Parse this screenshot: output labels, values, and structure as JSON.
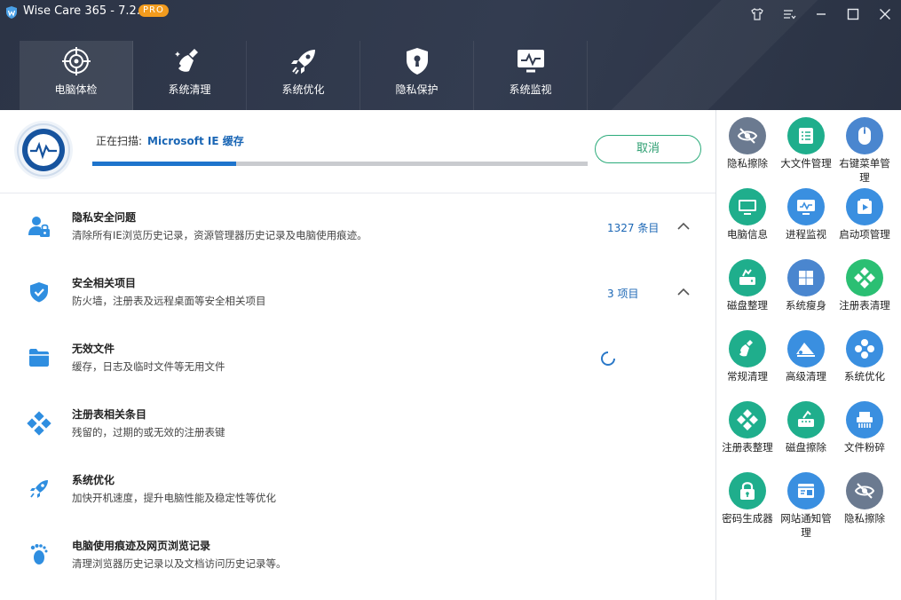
{
  "window": {
    "title": "Wise Care 365 - 7.2.5",
    "badge": "PRO",
    "controls": [
      "skin-icon",
      "menu-icon",
      "minimize-icon",
      "maximize-icon",
      "close-icon"
    ]
  },
  "tabs": [
    {
      "label": "电脑体检",
      "icon": "target-icon",
      "active": true
    },
    {
      "label": "系统清理",
      "icon": "broom-icon",
      "active": false
    },
    {
      "label": "系统优化",
      "icon": "rocket-icon",
      "active": false
    },
    {
      "label": "隐私保护",
      "icon": "shield-keyhole-icon",
      "active": false
    },
    {
      "label": "系统监视",
      "icon": "monitor-icon",
      "active": false
    }
  ],
  "scan": {
    "prefix": "正在扫描:",
    "target": "Microsoft IE 缓存",
    "progress": 0.29,
    "cancel_label": "取消"
  },
  "categories": [
    {
      "title": "隐私安全问题",
      "desc": "清除所有IE浏览历史记录，资源管理器历史记录及电脑使用痕迹。",
      "count": "1327 条目",
      "icon": "user-lock-icon",
      "expanded": true
    },
    {
      "title": "安全相关项目",
      "desc": "防火墙，注册表及远程桌面等安全相关项目",
      "count": "3 项目",
      "icon": "shield-check-icon",
      "expanded": true
    },
    {
      "title": "无效文件",
      "desc": "缓存，日志及临时文件等无用文件",
      "count": "",
      "icon": "folder-icon",
      "scanning": true
    },
    {
      "title": "注册表相关条目",
      "desc": "残留的，过期的或无效的注册表键",
      "count": "",
      "icon": "registry-icon"
    },
    {
      "title": "系统优化",
      "desc": "加快开机速度，提升电脑性能及稳定性等优化",
      "count": "",
      "icon": "rocket-small-icon"
    },
    {
      "title": "电脑使用痕迹及网页浏览记录",
      "desc": "清理浏览器历史记录以及文档访问历史记录等。",
      "count": "",
      "icon": "footprint-icon"
    }
  ],
  "tools": [
    {
      "label": "隐私擦除",
      "icon": "eye-off-icon",
      "color": "#6b7a90"
    },
    {
      "label": "大文件管理",
      "icon": "file-list-icon",
      "color": "#1fae8c"
    },
    {
      "label": "右键菜单管理",
      "icon": "mouse-icon",
      "color": "#4a86cf"
    },
    {
      "label": "电脑信息",
      "icon": "computer-icon",
      "color": "#1fae8c"
    },
    {
      "label": "进程监视",
      "icon": "process-monitor-icon",
      "color": "#3a8fe0"
    },
    {
      "label": "启动项管理",
      "icon": "startup-icon",
      "color": "#3a8fe0"
    },
    {
      "label": "磁盘整理",
      "icon": "disk-defrag-icon",
      "color": "#1fae8c"
    },
    {
      "label": "系统瘦身",
      "icon": "windows-icon",
      "color": "#4a86cf"
    },
    {
      "label": "注册表清理",
      "icon": "registry-clean-icon",
      "color": "#2bbf73"
    },
    {
      "label": "常规清理",
      "icon": "broom-clean-icon",
      "color": "#1fae8c"
    },
    {
      "label": "高级清理",
      "icon": "eraser-icon",
      "color": "#3a8fe0"
    },
    {
      "label": "系统优化",
      "icon": "gear-flower-icon",
      "color": "#3a8fe0"
    },
    {
      "label": "注册表整理",
      "icon": "registry-defrag-icon",
      "color": "#1fae8c"
    },
    {
      "label": "磁盘擦除",
      "icon": "disk-wipe-icon",
      "color": "#1fae8c"
    },
    {
      "label": "文件粉碎",
      "icon": "shredder-icon",
      "color": "#3a8fe0"
    },
    {
      "label": "密码生成器",
      "icon": "password-lock-icon",
      "color": "#1fae8c"
    },
    {
      "label": "网站通知管理",
      "icon": "web-notify-icon",
      "color": "#3a8fe0"
    },
    {
      "label": "隐私擦除",
      "icon": "eye-off-icon",
      "color": "#6b7a90"
    }
  ]
}
